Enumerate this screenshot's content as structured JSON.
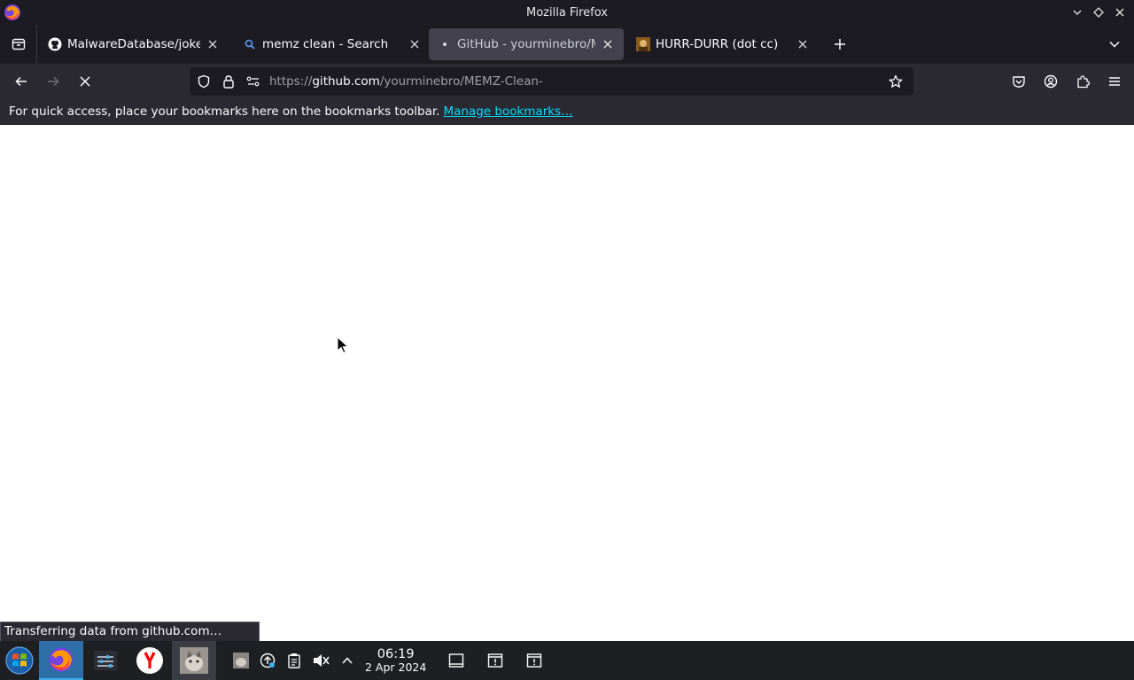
{
  "window": {
    "title": "Mozilla Firefox"
  },
  "tabs": [
    {
      "label": "MalwareDatabase/jokes/M",
      "favicon": "github-icon",
      "active": false
    },
    {
      "label": "memz clean - Search",
      "favicon": "search-icon",
      "active": false
    },
    {
      "label": "GitHub - yourminebro/ME",
      "favicon": "loading-dot-icon",
      "active": true
    },
    {
      "label": "HURR-DURR (dot cc)",
      "favicon": "site-thumbnail-icon",
      "active": false
    }
  ],
  "urlbar": {
    "scheme": "https://",
    "host": "github.com",
    "path": "/yourminebro/MEMZ-Clean-"
  },
  "bookmarks_bar": {
    "message": "For quick access, place your bookmarks here on the bookmarks toolbar.",
    "link": "Manage bookmarks…"
  },
  "status": {
    "text": "Transferring data from github.com…"
  },
  "taskbar": {
    "time": "06:19",
    "date": "2 Apr 2024"
  },
  "colors": {
    "chrome_dark": "#1c1b22",
    "toolbar": "#2b2a33",
    "link": "#00ddff",
    "taskbar": "#1e1f23",
    "taskbar_active": "#2e6fa8"
  }
}
